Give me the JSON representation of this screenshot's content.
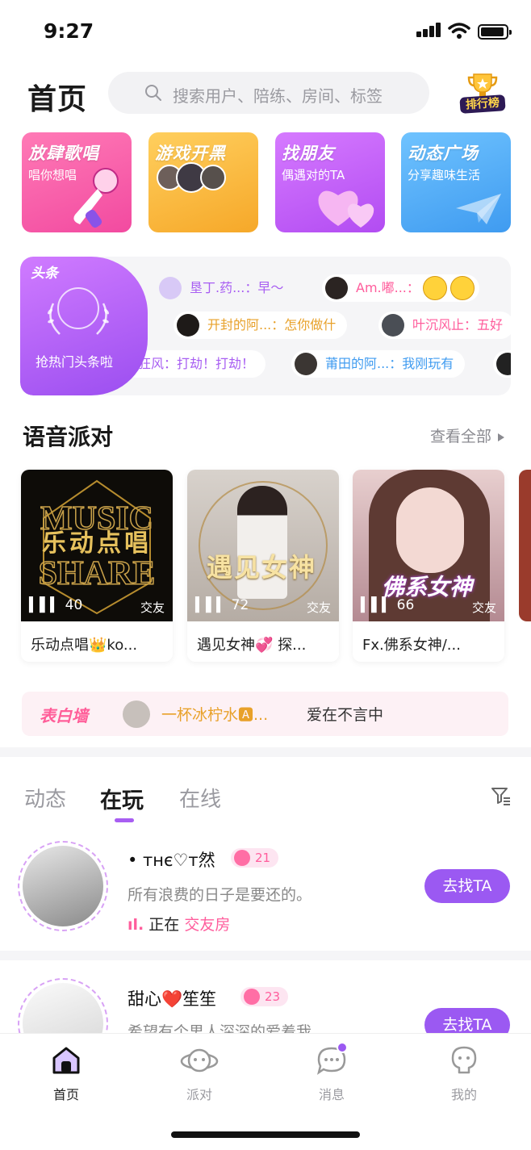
{
  "status_bar": {
    "time": "9:27"
  },
  "header": {
    "title": "首页",
    "search_placeholder": "搜索用户、陪练、房间、标签",
    "rank_label": "排行榜"
  },
  "features": [
    {
      "title": "放肆歌唱",
      "subtitle": "唱你想唱",
      "color": "#f24aa0"
    },
    {
      "title": "游戏开黑",
      "subtitle": "",
      "color": "#f6a829"
    },
    {
      "title": "找朋友",
      "subtitle": "偶遇对的TA",
      "color": "#b24cf2"
    },
    {
      "title": "动态广场",
      "subtitle": "分享趣味生活",
      "color": "#3f9bf0"
    }
  ],
  "headlines": {
    "tag": "头条",
    "cta": "抢热门头条啦",
    "messages": [
      {
        "text": "垦丁.药...：早～",
        "color": "#a85ef2"
      },
      {
        "text": "Am.嘟...：",
        "color": "#ff5d9c"
      },
      {
        "text": "开封的阿...：怎你做什",
        "color": "#e8a12a"
      },
      {
        "text": "叶沉风止：五好",
        "color": "#ff5d9c"
      },
      {
        "text": "狂风：打劫！打劫！",
        "color": "#a85ef2"
      },
      {
        "text": "莆田的阿...：我刚玩有",
        "color": "#3f9bf0"
      }
    ]
  },
  "voice_party": {
    "title": "语音派对",
    "see_all": "查看全部",
    "rooms": [
      {
        "count": "40",
        "type": "交友",
        "name": "乐动点唱👑ko...",
        "cover_text": "乐动点唱"
      },
      {
        "count": "72",
        "type": "交友",
        "name": "遇见女神💞 探...",
        "cover_text": "遇见女神"
      },
      {
        "count": "66",
        "type": "交友",
        "name": "Fx.佛系女神/...",
        "cover_text": "佛系女神"
      }
    ]
  },
  "confession_wall": {
    "logo": "表白墙",
    "from": "一杯冰柠水🅰...",
    "message": "爱在不言中"
  },
  "feed": {
    "tabs": [
      "动态",
      "在玩",
      "在线"
    ],
    "users": [
      {
        "name": "• ᴛʜє♡ᴛ然",
        "age": "21",
        "bio": "所有浪费的日子是要还的。",
        "status_prefix": "正在",
        "room": "交友房",
        "button": "去找TA"
      },
      {
        "name": "甜心❤️笙笙",
        "age": "23",
        "bio": "希望有个男人深深的爱着我",
        "button": "去找TA"
      }
    ]
  },
  "nav": [
    {
      "label": "首页",
      "icon": "home-icon"
    },
    {
      "label": "派对",
      "icon": "party-planet-icon"
    },
    {
      "label": "消息",
      "icon": "message-icon"
    },
    {
      "label": "我的",
      "icon": "profile-icon"
    }
  ]
}
